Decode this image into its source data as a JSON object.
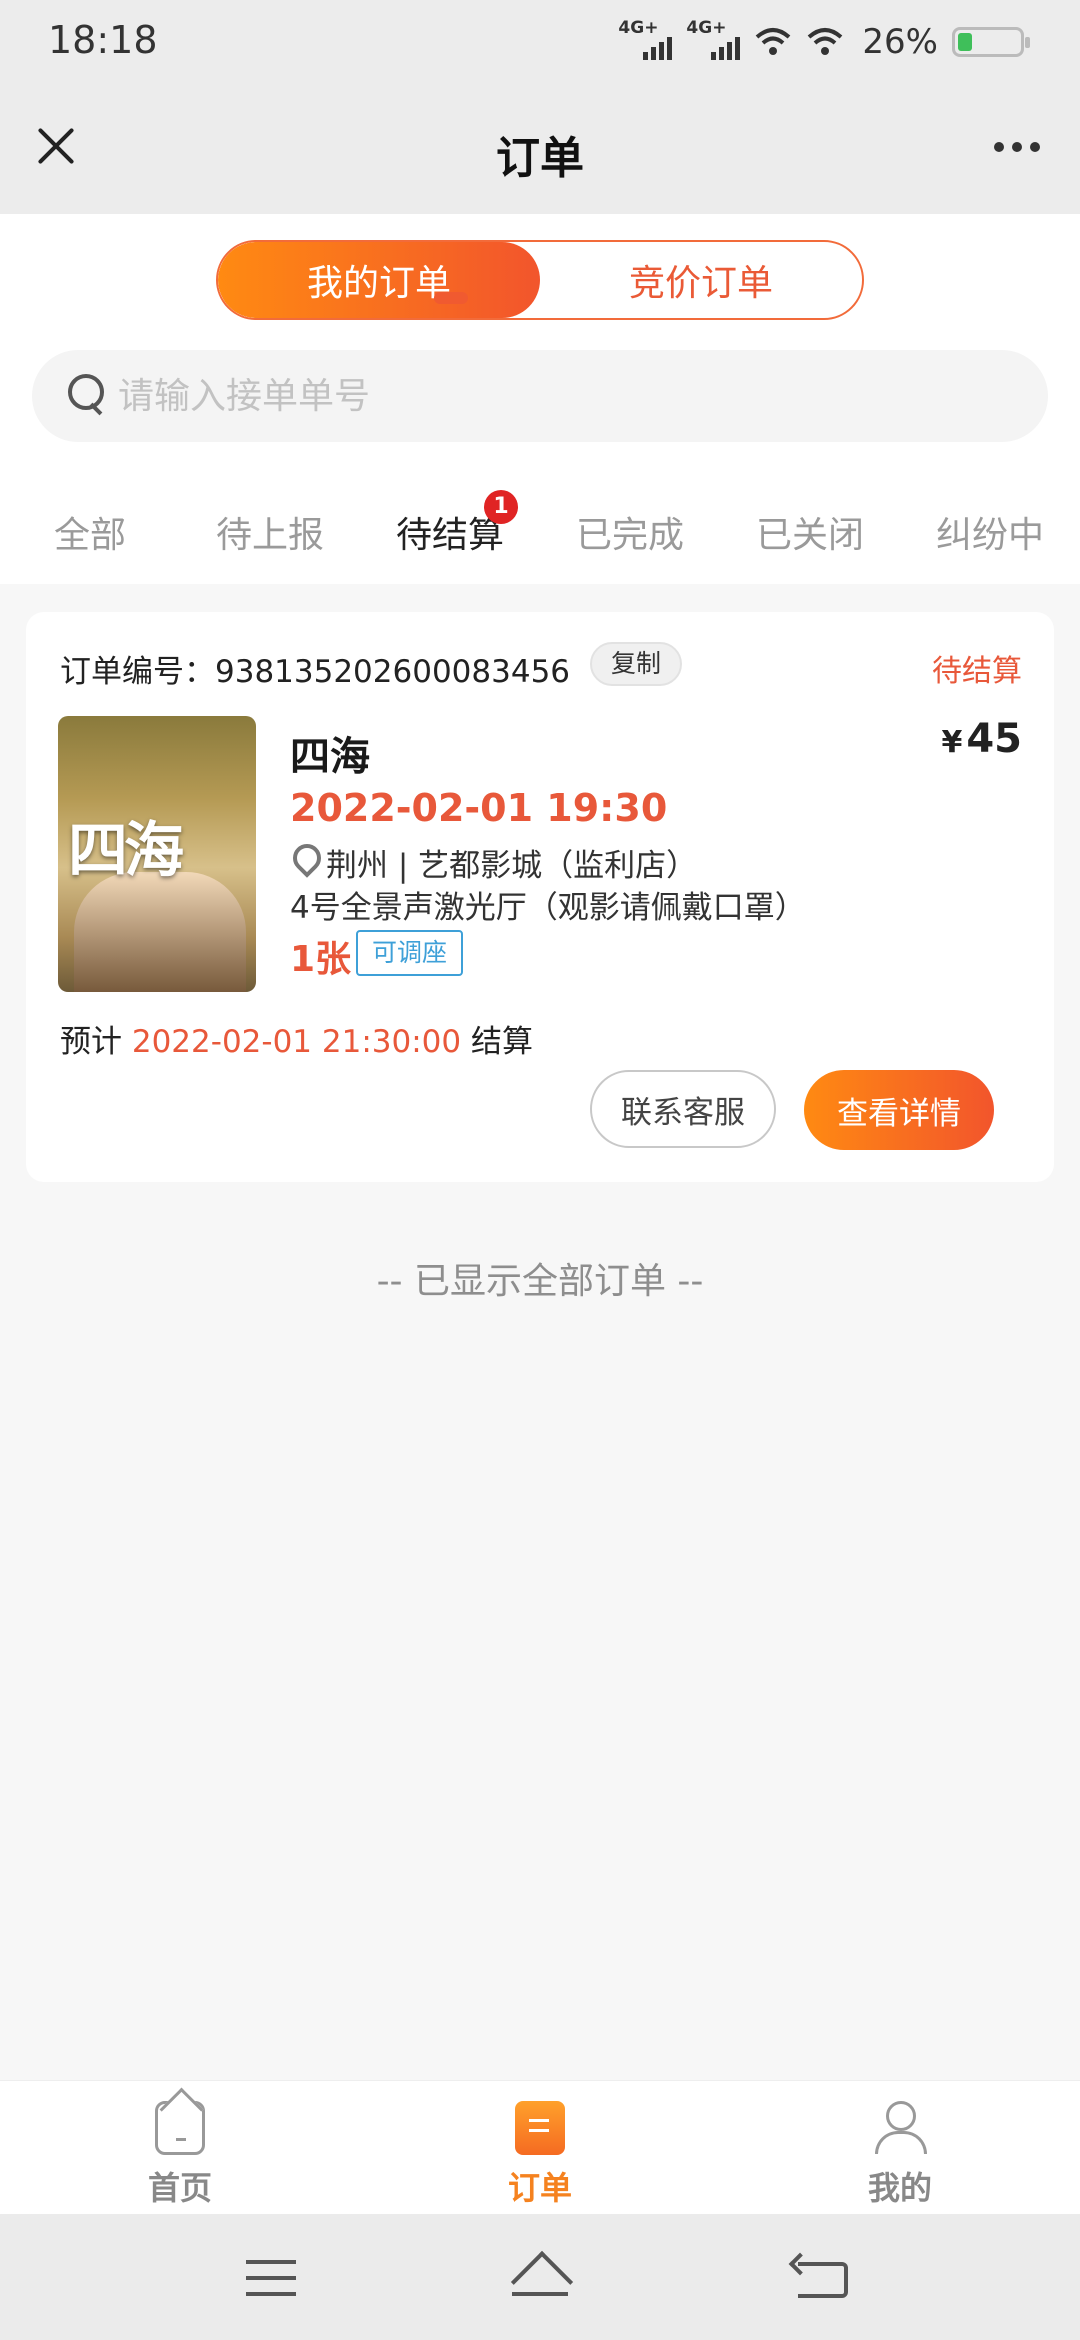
{
  "status_bar": {
    "time": "18:18",
    "network_1": "4G+",
    "network_2": "4G+",
    "battery_pct": "26%"
  },
  "nav": {
    "title": "订单"
  },
  "segments": {
    "mine": "我的订单",
    "bidding": "竞价订单"
  },
  "search": {
    "placeholder": "请输入接单单号"
  },
  "tabs": [
    {
      "label": "全部"
    },
    {
      "label": "待上报"
    },
    {
      "label": "待结算",
      "badge": "1"
    },
    {
      "label": "已完成"
    },
    {
      "label": "已关闭"
    },
    {
      "label": "纠纷中"
    }
  ],
  "order": {
    "order_no_label": "订单编号：",
    "order_no": "938135202600083456",
    "copy_label": "复制",
    "status": "待结算",
    "poster_text": "四海",
    "movie_title": "四海",
    "currency": "¥",
    "price": "45",
    "show_time": "2022-02-01 19:30",
    "location": "荆州 | 艺都影城（监利店）",
    "hall": "4号全景声激光厅（观影请佩戴口罩）",
    "ticket_count": "1张",
    "seat_tag": "可调座",
    "settle_prefix": "预计",
    "settle_time": "2022-02-01 21:30:00",
    "settle_suffix": "结算",
    "contact_label": "联系客服",
    "detail_label": "查看详情"
  },
  "end_note": "-- 已显示全部订单 --",
  "bottom_nav": {
    "home": "首页",
    "orders": "订单",
    "me": "我的"
  },
  "colors": {
    "accent": "#f26b3a",
    "accent_gradient_start": "#ff8a12",
    "accent_gradient_end": "#f2552c",
    "red_text": "#e8583a",
    "tag_blue": "#3ea0d8"
  }
}
